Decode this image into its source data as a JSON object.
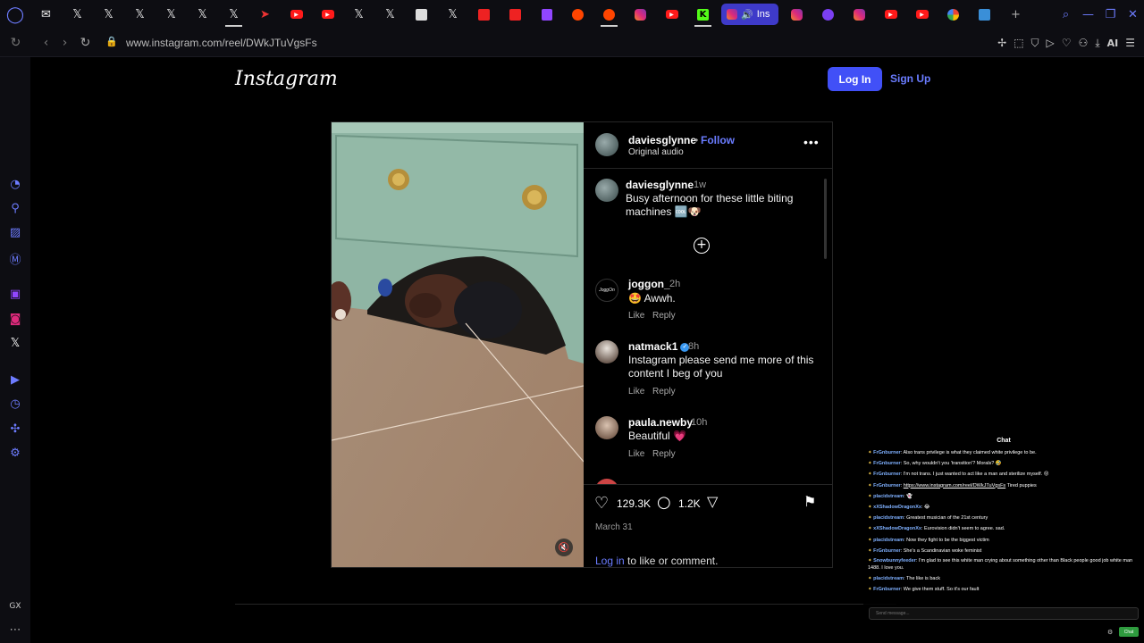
{
  "browser": {
    "url": "www.instagram.com/reel/DWkJTuVgsFs",
    "active_tab_label": "Ins",
    "ai_label": "AI"
  },
  "header": {
    "logo_text": "Instagram",
    "login_label": "Log In",
    "signup_label": "Sign Up"
  },
  "post": {
    "author": "daviesglynne",
    "separator": "•",
    "follow_label": "Follow",
    "audio": "Original audio",
    "caption": {
      "user": "daviesglynne",
      "time": "1w",
      "text": "Busy afternoon for these little biting machines 🆒🐶"
    },
    "comments": [
      {
        "user": "joggon_",
        "time": "2h",
        "text": "🤩 Awwh.",
        "verified": false,
        "like": "Like",
        "reply": "Reply",
        "avatar_text": "JoggOn"
      },
      {
        "user": "natmack1",
        "time": "8h",
        "text": "Instagram please send me more of this content I beg of you",
        "verified": true,
        "like": "Like",
        "reply": "Reply"
      },
      {
        "user": "paula.newby",
        "time": "10h",
        "text": "Beautiful 💗",
        "verified": false,
        "like": "Like",
        "reply": "Reply"
      }
    ],
    "likes": "129.3K",
    "comment_count": "1.2K",
    "date": "March 31",
    "login_link": "Log in",
    "login_suffix": " to like or comment."
  },
  "chat": {
    "title": "Chat",
    "messages": [
      {
        "name": "FrGnburner",
        "text": ": Also trans privilege is what they claimed white privilege to be."
      },
      {
        "name": "FrGnburner",
        "text": ": So, why wouldn't you 'transition'? Morals? 🤣"
      },
      {
        "name": "FrGnburner",
        "text": ": I'm not trans. I just wanted to act like a man and sterilize myself. 😝"
      },
      {
        "name": "FrGnburner",
        "text": ": ",
        "link": "https://www.instagram.com/reel/DWkJTuVgsFs",
        "after": " Tired puppies"
      },
      {
        "name": "placidstream",
        "text": ": 👻"
      },
      {
        "name": "xXShadowDragonXx",
        "text": ": 😂"
      },
      {
        "name": "placidstream",
        "text": ": Greatest musician of the 21st century"
      },
      {
        "name": "xXShadowDragonXx",
        "text": ": Eurovision didn't seem to agree. sad."
      },
      {
        "name": "placidstream",
        "text": ": Now they fight to be the biggest victim"
      },
      {
        "name": "FrGnburner",
        "text": ": She's a Scandinavian woke feminist"
      },
      {
        "name": "Snowbunnyfeeder",
        "text": ": I'm glad to see this white man crying about something other than Black people good job white man 1488. I love you.",
        "wrap": true
      },
      {
        "name": "placidstream",
        "text": ": The like is back"
      },
      {
        "name": "FrGnburner",
        "text": ": We give them stuff. So it's our fault"
      }
    ],
    "input_placeholder": "Send message...",
    "send_label": "Chat"
  }
}
